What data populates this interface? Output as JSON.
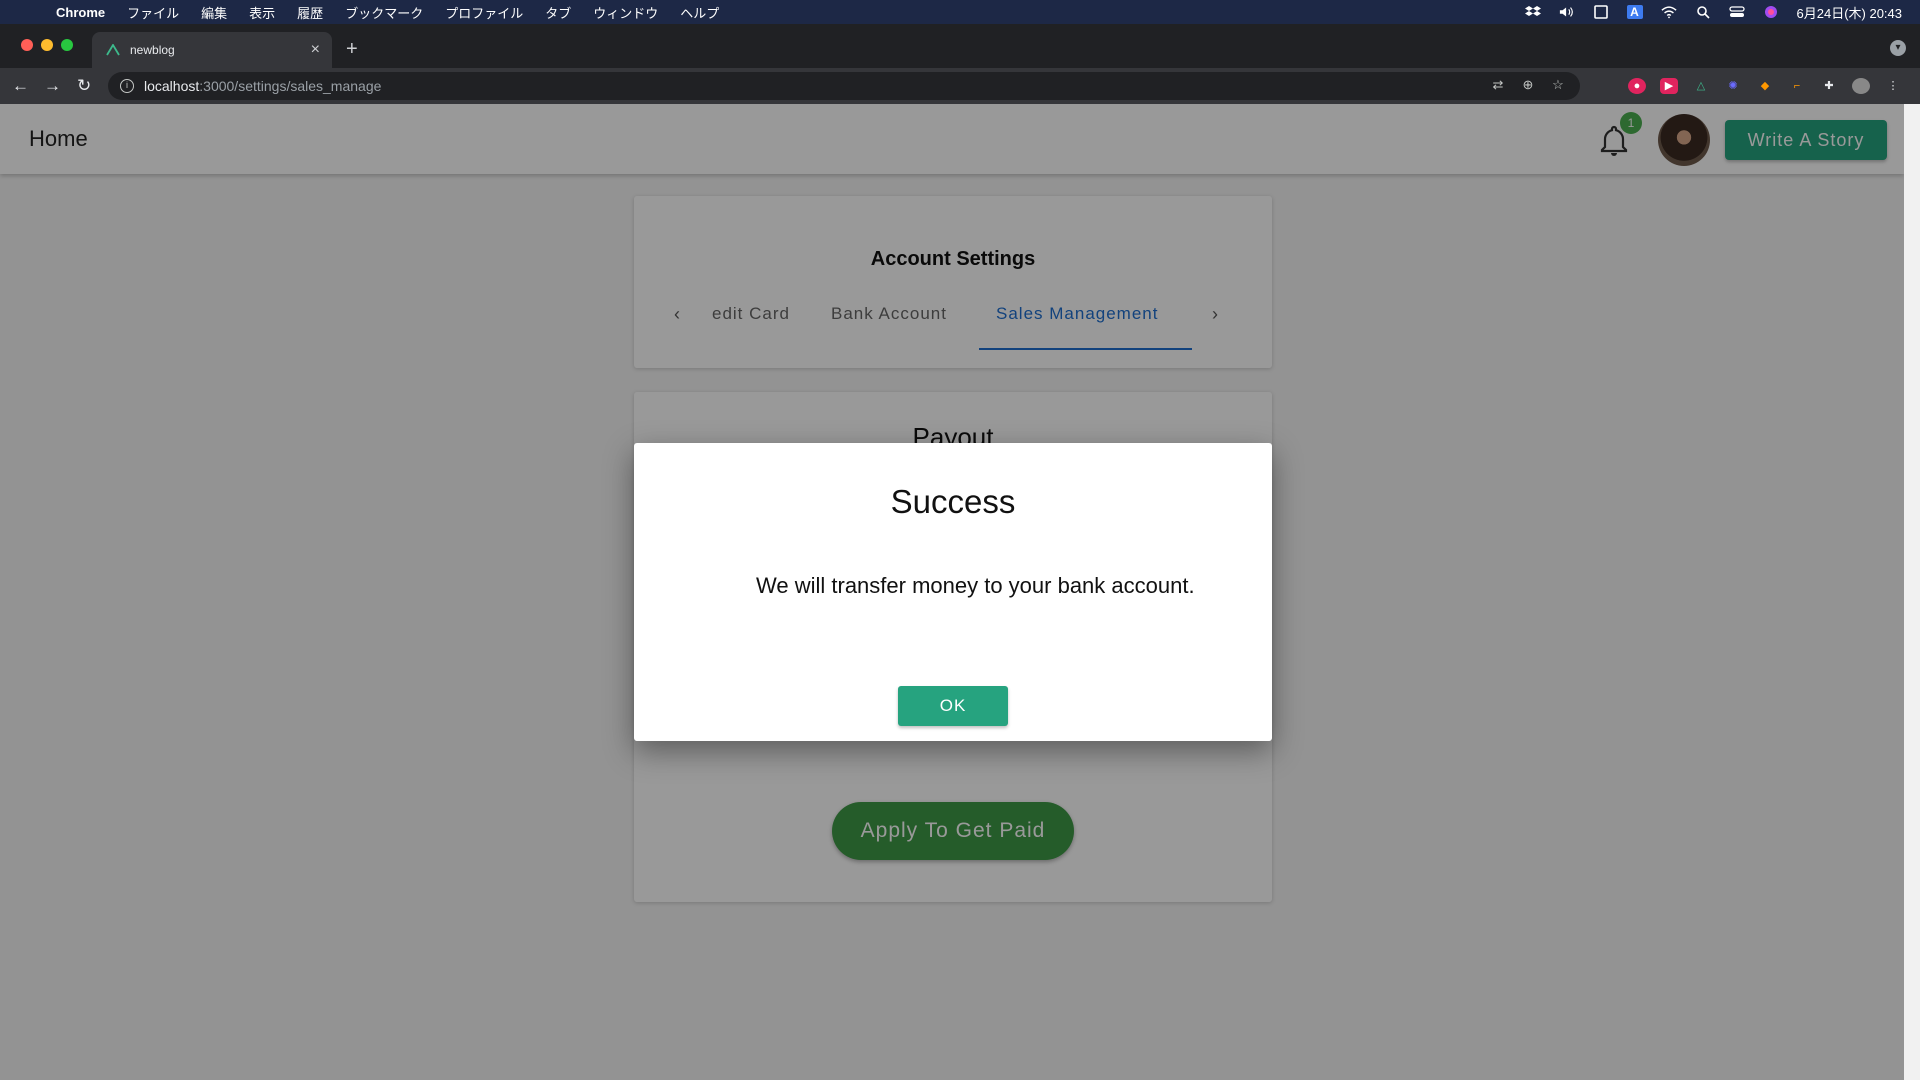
{
  "macos_menu": {
    "app": "Chrome",
    "items": [
      "ファイル",
      "編集",
      "表示",
      "履歴",
      "ブックマーク",
      "プロファイル",
      "タブ",
      "ウィンドウ",
      "ヘルプ"
    ],
    "datetime": "6月24日(木) 20:43",
    "status_icons": [
      "dropbox-icon",
      "volume-icon",
      "display-icon",
      "input-method-icon",
      "wifi-icon",
      "spotlight-icon",
      "control-center-icon",
      "siri-icon"
    ],
    "input_method_label": "A"
  },
  "browser": {
    "tab_title": "newblog",
    "url_host": "localhost",
    "url_path": ":3000/settings/sales_manage",
    "traffic_colors": [
      "#ff5f57",
      "#febc2e",
      "#28c840"
    ]
  },
  "appbar": {
    "home_label": "Home",
    "notification_count": "1",
    "write_button_label": "Write A Story"
  },
  "settings": {
    "title": "Account Settings",
    "tabs": [
      "edit Card",
      "Bank Account",
      "Sales Management"
    ],
    "active_tab_index": 2
  },
  "payout": {
    "title": "Payout",
    "apply_button_label": "Apply To Get Paid"
  },
  "dialog": {
    "title": "Success",
    "message": "We will transfer money to your bank account.",
    "ok_label": "OK"
  },
  "colors": {
    "accent_green": "#26a37f",
    "apply_green": "#3f9a46",
    "tab_active_blue": "#1e6fd0",
    "badge_green": "#4caf50"
  }
}
